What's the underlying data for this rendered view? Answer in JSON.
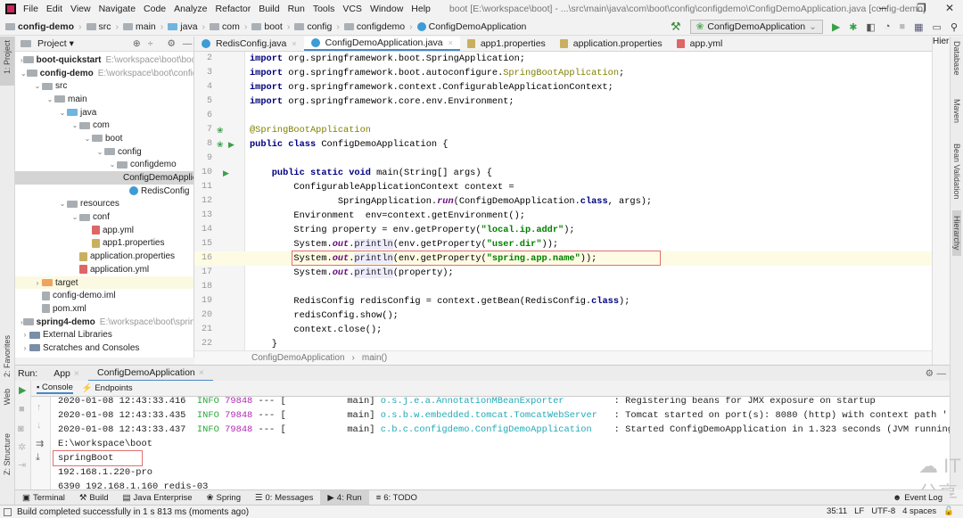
{
  "window": {
    "title": "boot [E:\\workspace\\boot] - ...\\src\\main\\java\\com\\boot\\config\\configdemo\\ConfigDemoApplication.java [config-demo]",
    "minimize": "─",
    "maximize": "❐",
    "close": "✕"
  },
  "menu": [
    "File",
    "Edit",
    "View",
    "Navigate",
    "Code",
    "Analyze",
    "Refactor",
    "Build",
    "Run",
    "Tools",
    "VCS",
    "Window",
    "Help"
  ],
  "breadcrumb": [
    "config-demo",
    "src",
    "main",
    "java",
    "com",
    "boot",
    "config",
    "configdemo",
    "ConfigDemoApplication"
  ],
  "toolbar": {
    "run_config": "ConfigDemoApplication"
  },
  "left_stripe": {
    "project": "1: Project",
    "favorites": "2: Favorites",
    "web": "Web",
    "structure": "Z: Structure"
  },
  "right_stripe": [
    "Database",
    "Maven",
    "Bean Validation",
    "Hierarchy"
  ],
  "project_panel": {
    "title": "Project ▾",
    "tree": [
      {
        "label": "boot-quickstart",
        "path": "E:\\workspace\\boot\\boot-",
        "depth": 0,
        "arrow": ">",
        "bold": true,
        "kind": "module"
      },
      {
        "label": "config-demo",
        "path": "E:\\workspace\\boot\\config-d",
        "depth": 0,
        "arrow": "v",
        "bold": true,
        "kind": "module"
      },
      {
        "label": "src",
        "depth": 1,
        "arrow": "v",
        "kind": "folder"
      },
      {
        "label": "main",
        "depth": 2,
        "arrow": "v",
        "kind": "folder"
      },
      {
        "label": "java",
        "depth": 3,
        "arrow": "v",
        "kind": "src"
      },
      {
        "label": "com",
        "depth": 4,
        "arrow": "v",
        "kind": "folder"
      },
      {
        "label": "boot",
        "depth": 5,
        "arrow": "v",
        "kind": "folder"
      },
      {
        "label": "config",
        "depth": 6,
        "arrow": "v",
        "kind": "folder"
      },
      {
        "label": "configdemo",
        "depth": 7,
        "arrow": "v",
        "kind": "folder"
      },
      {
        "label": "ConfigDemoApplication",
        "depth": 8,
        "kind": "class",
        "selected": true
      },
      {
        "label": "RedisConfig",
        "depth": 8,
        "kind": "class"
      },
      {
        "label": "resources",
        "depth": 3,
        "arrow": "v",
        "kind": "folder"
      },
      {
        "label": "conf",
        "depth": 4,
        "arrow": "v",
        "kind": "folder"
      },
      {
        "label": "app.yml",
        "depth": 5,
        "kind": "yml"
      },
      {
        "label": "app1.properties",
        "depth": 5,
        "kind": "props"
      },
      {
        "label": "application.properties",
        "depth": 4,
        "kind": "props"
      },
      {
        "label": "application.yml",
        "depth": 4,
        "kind": "yml"
      },
      {
        "label": "target",
        "depth": 1,
        "arrow": ">",
        "kind": "orange",
        "target": true
      },
      {
        "label": "config-demo.iml",
        "depth": 1,
        "kind": "file"
      },
      {
        "label": "pom.xml",
        "depth": 1,
        "kind": "file"
      },
      {
        "label": "spring4-demo",
        "path": "E:\\workspace\\boot\\spring4",
        "depth": 0,
        "arrow": ">",
        "bold": true,
        "kind": "module"
      },
      {
        "label": "External Libraries",
        "depth": 0,
        "arrow": ">",
        "kind": "lib"
      },
      {
        "label": "Scratches and Consoles",
        "depth": 0,
        "arrow": ">",
        "kind": "lib"
      }
    ]
  },
  "editor_tabs": [
    {
      "label": "RedisConfig.java",
      "active": false
    },
    {
      "label": "ConfigDemoApplication.java",
      "active": true
    },
    {
      "label": "app1.properties",
      "active": false
    },
    {
      "label": "application.properties",
      "active": false
    },
    {
      "label": "app.yml",
      "active": false
    }
  ],
  "hierarchy_label": "Hier:",
  "code": {
    "first_line": 2,
    "highlight_line": 16,
    "lines": [
      [
        [
          "kw",
          "import"
        ],
        [
          "pl",
          " org.springframework.boot.SpringApplication;"
        ]
      ],
      [
        [
          "kw",
          "import"
        ],
        [
          "pl",
          " org.springframework.boot.autoconfigure."
        ],
        [
          "ann",
          "SpringBootApplication"
        ],
        [
          "pl",
          ";"
        ]
      ],
      [
        [
          "kw",
          "import"
        ],
        [
          "pl",
          " org.springframework.context.ConfigurableApplicationContext;"
        ]
      ],
      [
        [
          "kw",
          "import"
        ],
        [
          "pl",
          " org.springframework.core.env.Environment;"
        ]
      ],
      [],
      [
        [
          "ann",
          "@SpringBootApplication"
        ]
      ],
      [
        [
          "kw",
          "public class"
        ],
        [
          "pl",
          " ConfigDemoApplication {"
        ]
      ],
      [],
      [
        [
          "pl",
          "    "
        ],
        [
          "kw",
          "public static void"
        ],
        [
          "pl",
          " main(String[] args) {"
        ]
      ],
      [
        [
          "pl",
          "        ConfigurableApplicationContext context ="
        ]
      ],
      [
        [
          "pl",
          "                SpringApplication."
        ],
        [
          "it",
          "run"
        ],
        [
          "pl",
          "(ConfigDemoApplication."
        ],
        [
          "kw",
          "class"
        ],
        [
          "pl",
          ", args);"
        ]
      ],
      [
        [
          "pl",
          "        Environment  env=context.getEnvironment();"
        ]
      ],
      [
        [
          "pl",
          "        String property = env.getProperty("
        ],
        [
          "str",
          "\"local.ip.addr\""
        ],
        [
          "pl",
          ");"
        ]
      ],
      [
        [
          "pl",
          "        System."
        ],
        [
          "it",
          "out"
        ],
        [
          "pl",
          "."
        ],
        [
          "meth",
          "println"
        ],
        [
          "pl",
          "(env.getProperty("
        ],
        [
          "str",
          "\"user.dir\""
        ],
        [
          "pl",
          "));"
        ]
      ],
      [
        [
          "pl",
          "        System."
        ],
        [
          "it",
          "out"
        ],
        [
          "pl",
          "."
        ],
        [
          "meth",
          "println"
        ],
        [
          "pl",
          "(env.getProperty("
        ],
        [
          "str",
          "\"spring.app.name\""
        ],
        [
          "pl",
          "));"
        ]
      ],
      [
        [
          "pl",
          "        System."
        ],
        [
          "it",
          "out"
        ],
        [
          "pl",
          "."
        ],
        [
          "meth",
          "println"
        ],
        [
          "pl",
          "(property);"
        ]
      ],
      [],
      [
        [
          "pl",
          "        RedisConfig redisConfig = context.getBean(RedisConfig."
        ],
        [
          "kw",
          "class"
        ],
        [
          "pl",
          ");"
        ]
      ],
      [
        [
          "pl",
          "        redisConfig.show();"
        ]
      ],
      [
        [
          "pl",
          "        context.close();"
        ]
      ],
      [
        [
          "pl",
          "    }"
        ]
      ]
    ]
  },
  "editor_breadcrumb": [
    "ConfigDemoApplication",
    "main()"
  ],
  "run_panel": {
    "label": "Run:",
    "tabs": [
      "App",
      "ConfigDemoApplication"
    ],
    "console_tabs": [
      "Console",
      "Endpoints"
    ]
  },
  "console": {
    "log": [
      {
        "time": "2020-01-08 12:43:33.416",
        "level": "INFO",
        "pid": "79848",
        "sep": "--- [",
        "thread": "           main]",
        "logger": "o.s.j.e.a.AnnotationMBeanExporter       ",
        "msg": ": Registering beans for JMX exposure on startup"
      },
      {
        "time": "2020-01-08 12:43:33.435",
        "level": "INFO",
        "pid": "79848",
        "sep": "--- [",
        "thread": "           main]",
        "logger": "o.s.b.w.embedded.tomcat.TomcatWebServer ",
        "msg": ": Tomcat started on port(s): 8080 (http) with context path ''"
      },
      {
        "time": "2020-01-08 12:43:33.437",
        "level": "INFO",
        "pid": "79848",
        "sep": "--- [",
        "thread": "           main]",
        "logger": "c.b.c.configdemo.ConfigDemoApplication  ",
        "msg": ": Started ConfigDemoApplication in 1.323 seconds (JVM running for"
      }
    ],
    "output": [
      "E:\\workspace\\boot",
      "springBoot",
      "192.168.1.220-pro",
      "6390 192.168.1.160 redis-03"
    ]
  },
  "bottom_tabs": [
    {
      "label": "Terminal"
    },
    {
      "label": "Build"
    },
    {
      "label": "Java Enterprise"
    },
    {
      "label": "Spring"
    },
    {
      "label": "0: Messages"
    },
    {
      "label": "4: Run",
      "active": true
    },
    {
      "label": "6: TODO"
    }
  ],
  "event_log": "Event Log",
  "status": {
    "message": "Build completed successfully in 1 s 813 ms (moments ago)",
    "position": "35:11",
    "line_sep": "LF",
    "encoding": "UTF-8",
    "indent": "4 spaces"
  },
  "watermark": "IT分享",
  "watermark_url": "https://blog.csdn.net/Brave_heart4pzj"
}
